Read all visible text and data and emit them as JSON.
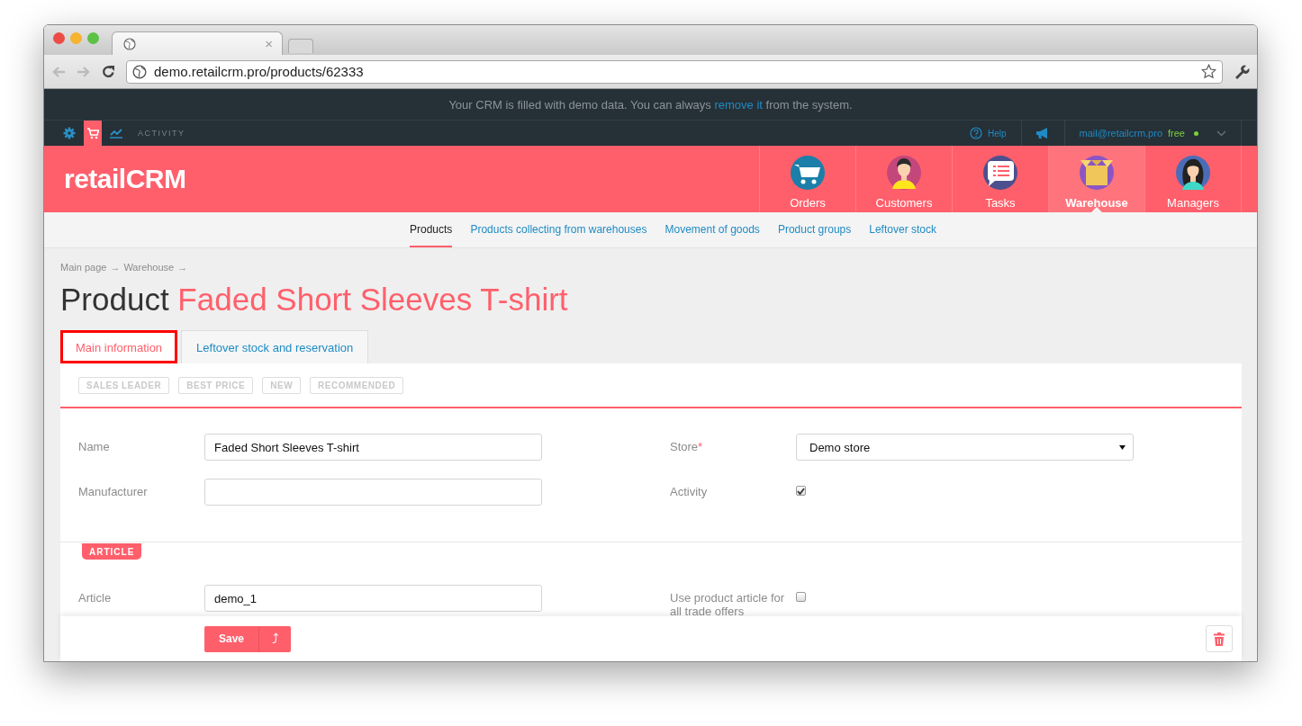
{
  "browser": {
    "tab_close": "×",
    "url": "demo.retailcrm.pro/products/62333"
  },
  "banner": {
    "text_before": "Your CRM is filled with demo data. You can always ",
    "link": "remove it",
    "text_after": " from the system."
  },
  "topbar": {
    "icons": [
      {
        "kind": "settings",
        "selected": false
      },
      {
        "kind": "cart",
        "selected": true
      },
      {
        "kind": "chart",
        "selected": false
      }
    ],
    "section": "ACTIVITY",
    "help": "Help",
    "email": "mail@retailcrm.pro",
    "plan": "free",
    "online": true
  },
  "header": {
    "logo": "retailCRM",
    "nav": [
      {
        "label": "Orders",
        "kind": "cart",
        "selected": false
      },
      {
        "label": "Customers",
        "kind": "customer",
        "selected": false
      },
      {
        "label": "Tasks",
        "kind": "tasks",
        "selected": false
      },
      {
        "label": "Warehouse",
        "kind": "box",
        "selected": true
      },
      {
        "label": "Managers",
        "kind": "manager",
        "selected": false
      }
    ]
  },
  "subnav": [
    {
      "label": "Products",
      "selected": true
    },
    {
      "label": "Products collecting from warehouses",
      "selected": false
    },
    {
      "label": "Movement of goods",
      "selected": false
    },
    {
      "label": "Product groups",
      "selected": false
    },
    {
      "label": "Leftover stock",
      "selected": false
    }
  ],
  "breadcrumb": [
    {
      "label": "Main page",
      "separator": "→"
    },
    {
      "label": "Warehouse",
      "separator": "→"
    }
  ],
  "title": {
    "prefix": "Product",
    "name": "Faded Short Sleeves T-shirt"
  },
  "tabs": [
    {
      "label": "Main information",
      "selected": true,
      "highlighted": true
    },
    {
      "label": "Leftover stock and reservation",
      "selected": false,
      "highlighted": false
    }
  ],
  "tags": [
    {
      "label": "SALES LEADER",
      "on": false
    },
    {
      "label": "BEST PRICE",
      "on": false
    },
    {
      "label": "NEW",
      "on": false
    },
    {
      "label": "RECOMMENDED",
      "on": false
    }
  ],
  "main_fields": [
    {
      "label": "Name",
      "kind": "input",
      "value": "Faded Short Sleeves T-shirt"
    },
    {
      "label": "Store",
      "kind": "select",
      "value": "Demo store",
      "required_mark": "*"
    },
    {
      "label": "Manufacturer",
      "kind": "input"
    },
    {
      "label": "Activity",
      "kind": "checkbox",
      "checked": true
    }
  ],
  "section_tag": "ARTICLE",
  "article_fields": [
    {
      "label": "Article",
      "kind": "input",
      "value": "demo_1"
    },
    {
      "label": "Use product article for all trade offers",
      "kind": "checkbox",
      "checked": false
    }
  ],
  "actions": {
    "save": "Save",
    "more": "⤴"
  }
}
